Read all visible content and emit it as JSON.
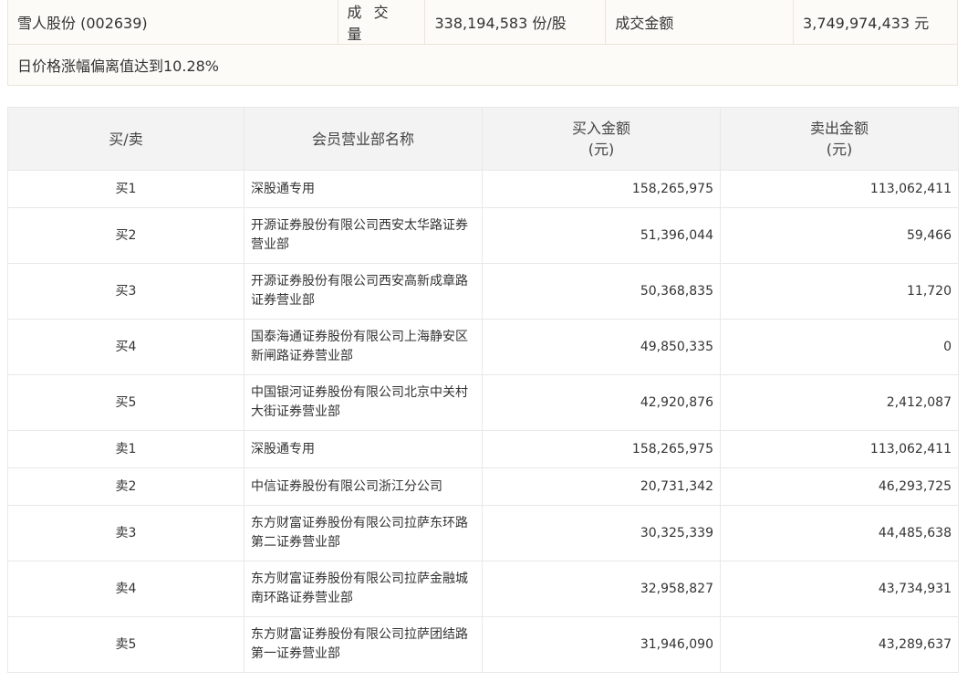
{
  "summary": {
    "stock": "雪人股份 (002639)",
    "volume_label": "成 交 量",
    "volume_value": "338,194,583 份/股",
    "amount_label": "成交金额",
    "amount_value": "3,749,974,433 元",
    "reason": "日价格涨幅偏离值达到10.28%"
  },
  "table": {
    "headers": {
      "direction": "买/卖",
      "member": "会员营业部名称",
      "buy": "买入金额\n(元)",
      "sell": "卖出金额\n(元)"
    },
    "rows": [
      {
        "direction": "买1",
        "member": "深股通专用",
        "buy": "158,265,975",
        "sell": "113,062,411"
      },
      {
        "direction": "买2",
        "member": "开源证券股份有限公司西安太华路证券营业部",
        "buy": "51,396,044",
        "sell": "59,466"
      },
      {
        "direction": "买3",
        "member": "开源证券股份有限公司西安高新成章路证券营业部",
        "buy": "50,368,835",
        "sell": "11,720"
      },
      {
        "direction": "买4",
        "member": "国泰海通证券股份有限公司上海静安区新闸路证券营业部",
        "buy": "49,850,335",
        "sell": "0"
      },
      {
        "direction": "买5",
        "member": "中国银河证券股份有限公司北京中关村大街证券营业部",
        "buy": "42,920,876",
        "sell": "2,412,087"
      },
      {
        "direction": "卖1",
        "member": "深股通专用",
        "buy": "158,265,975",
        "sell": "113,062,411"
      },
      {
        "direction": "卖2",
        "member": "中信证券股份有限公司浙江分公司",
        "buy": "20,731,342",
        "sell": "46,293,725"
      },
      {
        "direction": "卖3",
        "member": "东方财富证券股份有限公司拉萨东环路第二证券营业部",
        "buy": "30,325,339",
        "sell": "44,485,638"
      },
      {
        "direction": "卖4",
        "member": "东方财富证券股份有限公司拉萨金融城南环路证券营业部",
        "buy": "32,958,827",
        "sell": "43,734,931"
      },
      {
        "direction": "卖5",
        "member": "东方财富证券股份有限公司拉萨团结路第一证券营业部",
        "buy": "31,946,090",
        "sell": "43,289,637"
      }
    ]
  }
}
